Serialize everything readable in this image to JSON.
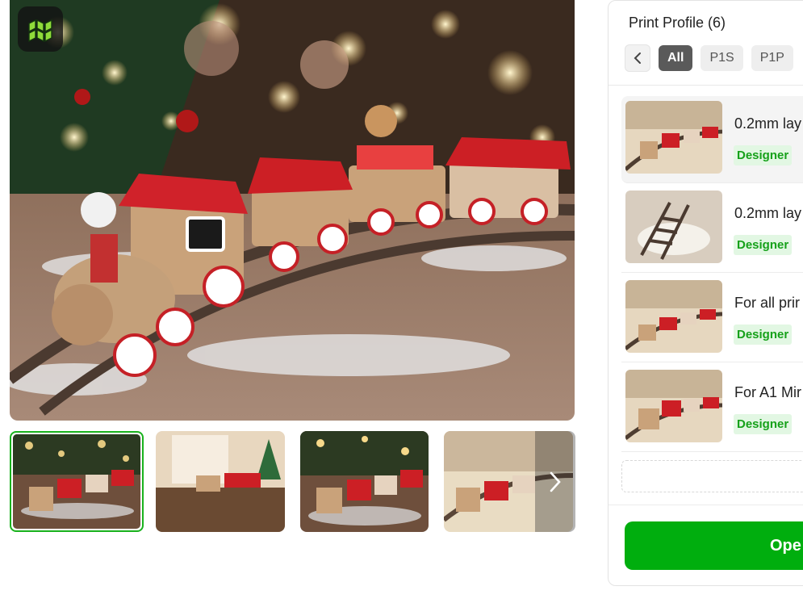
{
  "panel": {
    "title": "Print Profile (6)",
    "filters": [
      "All",
      "P1S",
      "P1P"
    ],
    "profiles": [
      {
        "name": "0.2mm lay",
        "badge": "Designer"
      },
      {
        "name": "0.2mm lay",
        "badge": "Designer"
      },
      {
        "name": "For all prir",
        "badge": "Designer"
      },
      {
        "name": "For A1 Mir",
        "badge": "Designer"
      }
    ],
    "open_label": "Ope"
  },
  "icons": {
    "brand": "makerworld-logo-icon",
    "prev": "chevron-left-icon",
    "next": "chevron-right-icon"
  },
  "colors": {
    "accent": "#00ae0e",
    "badge_bg": "#e2f7e3",
    "badge_text": "#16a11a",
    "chip_active": "#5a5a5a"
  }
}
